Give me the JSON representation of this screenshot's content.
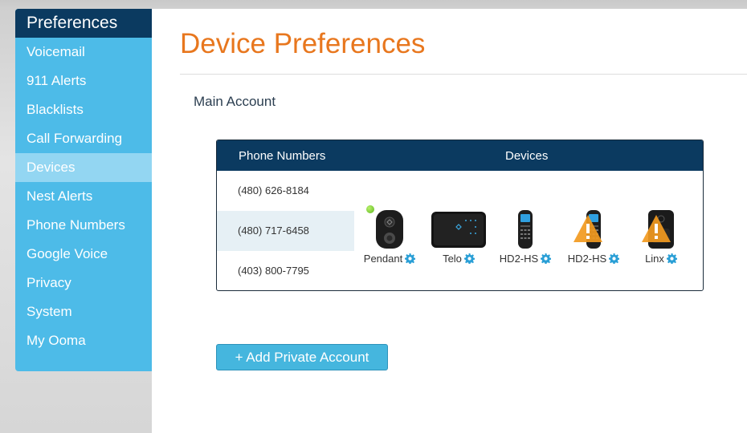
{
  "sidebar": {
    "title": "Preferences",
    "items": [
      {
        "label": "Voicemail"
      },
      {
        "label": "911 Alerts"
      },
      {
        "label": "Blacklists"
      },
      {
        "label": "Call Forwarding"
      },
      {
        "label": "Devices"
      },
      {
        "label": "Nest Alerts"
      },
      {
        "label": "Phone Numbers"
      },
      {
        "label": "Google Voice"
      },
      {
        "label": "Privacy"
      },
      {
        "label": "System"
      },
      {
        "label": "My Ooma"
      }
    ],
    "active_item": "Devices"
  },
  "main": {
    "title": "Device Preferences",
    "section_label": "Main Account",
    "table": {
      "headers": {
        "phone": "Phone Numbers",
        "devices": "Devices"
      },
      "phone_numbers": [
        "(480) 626-8184",
        "(480) 717-6458",
        "(403) 800-7795"
      ],
      "devices": [
        {
          "name": "Pendant",
          "icon": "pendant-device-icon",
          "status": "online",
          "warning": false
        },
        {
          "name": "Telo",
          "icon": "telo-base-station-icon",
          "status": "",
          "warning": false
        },
        {
          "name": "HD2-HS",
          "icon": "handset-icon",
          "status": "",
          "warning": false
        },
        {
          "name": "HD2-HS",
          "icon": "handset-icon",
          "status": "",
          "warning": true
        },
        {
          "name": "Linx",
          "icon": "linx-device-icon",
          "status": "",
          "warning": true
        }
      ]
    },
    "add_button": "+ Add Private Account"
  },
  "colors": {
    "sidebar_bg": "#4dbbe8",
    "sidebar_head": "#0b3a60",
    "title_orange": "#e8771e",
    "table_head": "#0b3a60",
    "button_bg": "#45b6de",
    "warning": "#f29a1f",
    "online": "#6cc62a"
  }
}
